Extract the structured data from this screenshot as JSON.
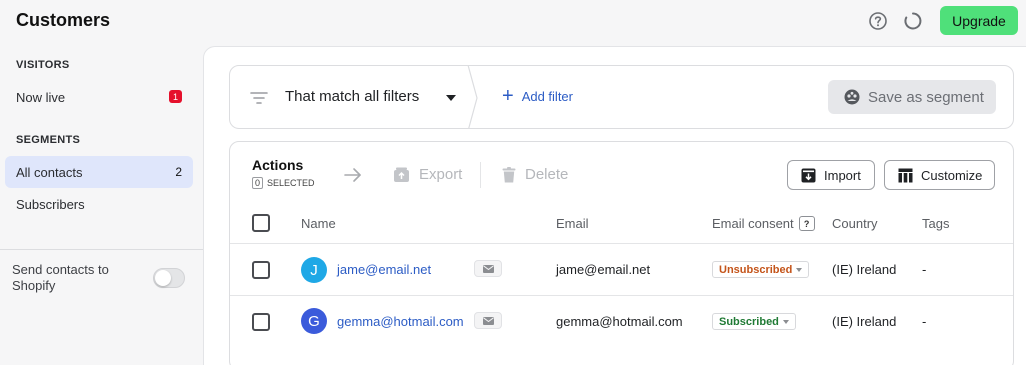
{
  "header": {
    "title": "Customers",
    "upgrade_label": "Upgrade",
    "icons": [
      "help-circle-icon",
      "loading-spinner-icon"
    ]
  },
  "sidebar": {
    "visitors_heading": "VISITORS",
    "now_live_label": "Now live",
    "now_live_badge": "1",
    "segments_heading": "SEGMENTS",
    "items": [
      {
        "label": "All contacts",
        "count": "2",
        "active": true
      },
      {
        "label": "Subscribers",
        "count": "",
        "active": false
      }
    ],
    "shopify_label": "Send contacts to Shopify",
    "shopify_toggle_on": false
  },
  "filter": {
    "match_label": "That match all filters",
    "add_filter_label": "Add filter",
    "save_segment_label": "Save as segment"
  },
  "actions": {
    "title": "Actions",
    "selected_count": "0",
    "selected_label": "SELECTED",
    "export_label": "Export",
    "delete_label": "Delete",
    "import_label": "Import",
    "customize_label": "Customize"
  },
  "table": {
    "columns": {
      "name": "Name",
      "email": "Email",
      "consent": "Email consent",
      "consent_help": "?",
      "country": "Country",
      "tags": "Tags"
    },
    "rows": [
      {
        "avatar_letter": "J",
        "avatar_color": "#1fa8e6",
        "name": "jame@email.net",
        "email": "jame@email.net",
        "consent": "Unsubscribed",
        "consent_color": "#c4541a",
        "country": "(IE) Ireland",
        "tags": "-"
      },
      {
        "avatar_letter": "G",
        "avatar_color": "#3b5bdb",
        "name": "gemma@hotmail.com",
        "email": "gemma@hotmail.com",
        "consent": "Subscribed",
        "consent_color": "#1f7a34",
        "country": "(IE) Ireland",
        "tags": "-"
      }
    ]
  },
  "colors": {
    "accent_blue": "#2c5cc5",
    "upgrade_green": "#4fe07a",
    "active_item_bg": "#dfe6fb",
    "badge_red": "#e5102c"
  }
}
